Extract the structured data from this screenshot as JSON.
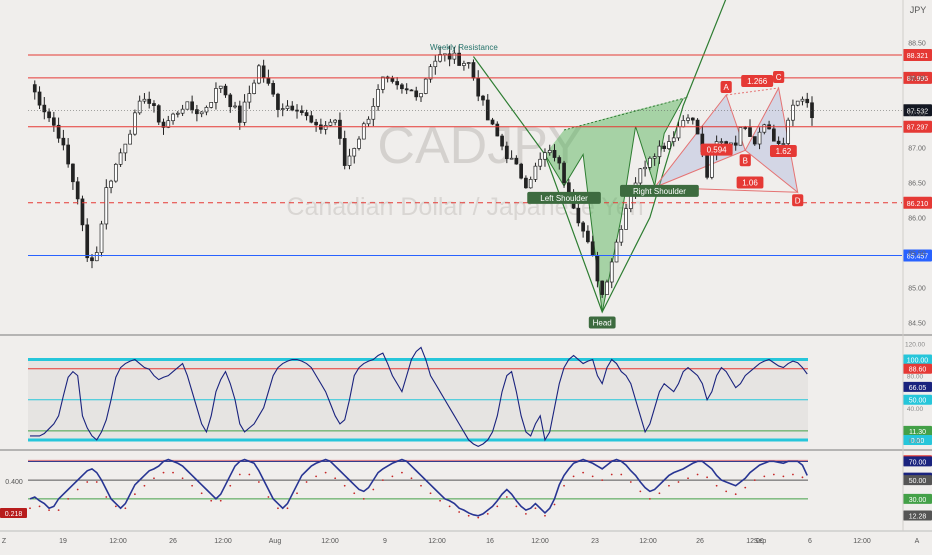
{
  "currency": "JPY",
  "watermark": {
    "symbol": "CADJPY",
    "name": "Canadian Dollar / Japanese Yen"
  },
  "colors": {
    "bg": "#f0eeec",
    "up": "#ffffff",
    "down": "#222222",
    "wick": "#222222",
    "resistance": "#e53935",
    "support": "#2962ff",
    "pattern_fill": "#4caf50",
    "pattern_line": "#2e7d32",
    "butterfly_fill": "#9fa8da",
    "butterfly_line": "#e57373",
    "osc_line": "#1a237e",
    "cyan": "#26c6da",
    "green_level": "#43a047",
    "sep": "#7a7a7a"
  },
  "chart_data": [
    {
      "type": "candlestick",
      "title": "",
      "ylim": [
        84.35,
        89.05
      ],
      "y_ticks": [
        84.5,
        85.0,
        85.5,
        86.0,
        86.5,
        87.0,
        87.5,
        88.0,
        88.5
      ],
      "x_tick_labels": [
        "Z",
        "19",
        "12:00",
        "26",
        "12:00",
        "Aug",
        "12:00",
        "9",
        "12:00",
        "16",
        "12:00",
        "23",
        "12:00",
        "26",
        "12:00",
        "Sep",
        "6",
        "12:00",
        "A"
      ],
      "anchors": [
        [
          0,
          87.9
        ],
        [
          6,
          87.2
        ],
        [
          10,
          86.3
        ],
        [
          12,
          85.4
        ],
        [
          14,
          85.5
        ],
        [
          16,
          86.4
        ],
        [
          20,
          87.1
        ],
        [
          24,
          87.75
        ],
        [
          28,
          87.3
        ],
        [
          32,
          87.6
        ],
        [
          36,
          87.5
        ],
        [
          40,
          87.9
        ],
        [
          44,
          87.4
        ],
        [
          48,
          88.15
        ],
        [
          52,
          87.6
        ],
        [
          56,
          87.6
        ],
        [
          60,
          87.25
        ],
        [
          64,
          87.4
        ],
        [
          66,
          86.75
        ],
        [
          70,
          87.3
        ],
        [
          74,
          87.95
        ],
        [
          78,
          87.8
        ],
        [
          82,
          87.8
        ],
        [
          84,
          88.2
        ],
        [
          86,
          88.3
        ],
        [
          88,
          88.3
        ],
        [
          92,
          88.2
        ],
        [
          96,
          87.4
        ],
        [
          100,
          86.9
        ],
        [
          104,
          86.5
        ],
        [
          108,
          86.9
        ],
        [
          110,
          86.9
        ],
        [
          114,
          86.2
        ],
        [
          118,
          85.4
        ],
        [
          120,
          84.9
        ],
        [
          122,
          85.4
        ],
        [
          126,
          86.4
        ],
        [
          130,
          86.9
        ],
        [
          134,
          87.1
        ],
        [
          138,
          87.5
        ],
        [
          140,
          87.2
        ],
        [
          142,
          86.6
        ],
        [
          144,
          87.05
        ],
        [
          148,
          87.1
        ],
        [
          150,
          87.35
        ],
        [
          152,
          87.1
        ],
        [
          154,
          87.4
        ],
        [
          156,
          87.1
        ],
        [
          158,
          87.05
        ],
        [
          160,
          87.6
        ],
        [
          162,
          87.75
        ],
        [
          164,
          87.4
        ]
      ],
      "levels": [
        {
          "label": "88.321",
          "value": 88.321,
          "style": "solid",
          "color": "#e53935"
        },
        {
          "label": "87.995",
          "value": 87.995,
          "style": "solid",
          "color": "#e53935"
        },
        {
          "label": "87.297",
          "value": 87.297,
          "style": "solid",
          "color": "#e53935"
        },
        {
          "label": "86.210",
          "value": 86.21,
          "style": "dashed",
          "color": "#e53935"
        },
        {
          "label": "85.457",
          "value": 85.457,
          "style": "solid",
          "color": "#2962ff"
        }
      ],
      "price_label": {
        "label": "87.532",
        "value": 87.532
      },
      "annotations": {
        "weekly_resistance": "Weekly Resistance",
        "left_shoulder": "Left Shoulder",
        "head": "Head",
        "right_shoulder": "Right Shoulder",
        "points": {
          "A": "A",
          "B": "B",
          "C": "C",
          "D": "D"
        },
        "ratios": {
          "ab": "0.594",
          "ac": "1.266",
          "bd": "1.62",
          "xd": "1.06"
        }
      },
      "pattern": {
        "hs_path": [
          [
            108,
            86.9
          ],
          [
            112,
            86.45
          ],
          [
            116,
            86.9
          ],
          [
            120,
            84.65
          ],
          [
            124,
            86.0
          ],
          [
            127,
            87.3
          ],
          [
            131,
            86.45
          ],
          [
            133,
            87.2
          ],
          [
            137,
            87.7
          ]
        ],
        "trend_line": [
          [
            93,
            88.3
          ],
          [
            108,
            86.9
          ],
          [
            120,
            84.65
          ],
          [
            130,
            86.0
          ],
          [
            137,
            87.6
          ],
          [
            147,
            89.3
          ]
        ],
        "butterfly": {
          "X": [
            131,
            86.43
          ],
          "A": [
            146,
            87.75
          ],
          "B": [
            150,
            86.96
          ],
          "C": [
            157,
            87.85
          ],
          "D": [
            161,
            86.36
          ]
        }
      }
    },
    {
      "type": "line",
      "title": "",
      "ylim": [
        -10,
        128
      ],
      "y_ticks": [
        0.0,
        40.0,
        80.0,
        120.0
      ],
      "levels": [
        {
          "label": "100.00",
          "value": 100.0,
          "color": "#26c6da"
        },
        {
          "label": "88.60",
          "value": 88.6,
          "color": "#e53935"
        },
        {
          "label": "66.05",
          "value": 66.05,
          "color": "#1a237e"
        },
        {
          "label": "50.00",
          "value": 50.0,
          "color": "#26c6da"
        },
        {
          "label": "11.30",
          "value": 11.3,
          "color": "#43a047"
        },
        {
          "label": "0.00",
          "value": 0.0,
          "color": "#26c6da"
        }
      ],
      "series": [
        {
          "values": [
            5,
            5,
            5,
            8,
            14,
            20,
            30,
            55,
            78,
            85,
            80,
            30,
            15,
            5,
            0,
            10,
            25,
            50,
            78,
            90,
            95,
            98,
            100,
            95,
            90,
            88,
            80,
            75,
            78,
            80,
            85,
            90,
            95,
            80,
            60,
            40,
            20,
            10,
            30,
            60,
            75,
            85,
            70,
            50,
            20,
            10,
            15,
            20,
            30,
            40,
            60,
            80,
            90,
            95,
            98,
            100,
            100,
            98,
            95,
            90,
            80,
            70,
            60,
            45,
            30,
            20,
            25,
            50,
            80,
            90,
            95,
            98,
            100,
            105,
            108,
            95,
            80,
            70,
            60,
            80,
            100,
            110,
            115,
            100,
            80,
            70,
            60,
            50,
            40,
            30,
            20,
            10,
            0,
            -5,
            -8,
            -5,
            0,
            10,
            30,
            60,
            80,
            85,
            60,
            30,
            10,
            5,
            20,
            30,
            0,
            10,
            40,
            70,
            90,
            100,
            105,
            100,
            95,
            98,
            100,
            80,
            70,
            90,
            100,
            95,
            85,
            80,
            70,
            50,
            30,
            10,
            20,
            40,
            60,
            70,
            65,
            60,
            70,
            85,
            90,
            85,
            80,
            70,
            50,
            60,
            80,
            90,
            85,
            75,
            65,
            70,
            80,
            85,
            90,
            95,
            98,
            100,
            96,
            92,
            90,
            95,
            98,
            96,
            90,
            82
          ]
        }
      ]
    },
    {
      "type": "line",
      "title": "",
      "ylim": [
        0,
        80
      ],
      "y_ticks": [
        0.4
      ],
      "y_tick_label": "0.400",
      "left_value": "0.218",
      "levels": [
        {
          "label": "71.16",
          "value": 71.16,
          "color": "#e53935"
        },
        {
          "label": "70.00",
          "value": 70.0,
          "color": "#1a237e"
        },
        {
          "label": "52.69",
          "value": 52.69,
          "color": "#1a237e"
        },
        {
          "label": "50.00",
          "value": 50.0,
          "color": "#555555"
        },
        {
          "label": "30.00",
          "value": 30.0,
          "color": "#43a047"
        },
        {
          "label": "12.28",
          "value": 12.28,
          "color": "#555555"
        }
      ],
      "series": [
        {
          "values": [
            30,
            32,
            28,
            25,
            20,
            22,
            30,
            35,
            40,
            45,
            50,
            55,
            60,
            62,
            58,
            50,
            40,
            30,
            25,
            20,
            25,
            35,
            45,
            50,
            55,
            60,
            62,
            65,
            70,
            72,
            70,
            68,
            65,
            60,
            55,
            50,
            45,
            40,
            35,
            30,
            35,
            45,
            55,
            65,
            70,
            72,
            70,
            68,
            60,
            50,
            40,
            30,
            25,
            20,
            25,
            35,
            45,
            55,
            60,
            65,
            68,
            70,
            72,
            70,
            65,
            60,
            55,
            50,
            45,
            40,
            38,
            42,
            50,
            58,
            62,
            65,
            68,
            70,
            72,
            70,
            65,
            60,
            55,
            50,
            45,
            40,
            35,
            30,
            28,
            25,
            20,
            18,
            15,
            13,
            12,
            14,
            18,
            22,
            28,
            35,
            40,
            35,
            28,
            22,
            18,
            20,
            25,
            20,
            15,
            20,
            30,
            45,
            55,
            62,
            68,
            70,
            72,
            70,
            68,
            65,
            62,
            66,
            70,
            72,
            70,
            66,
            60,
            55,
            48,
            42,
            38,
            40,
            45,
            50,
            55,
            58,
            60,
            62,
            65,
            68,
            70,
            70,
            66,
            62,
            55,
            50,
            48,
            46,
            44,
            48,
            52,
            58,
            62,
            66,
            68,
            70,
            70,
            69,
            68,
            70,
            70,
            70,
            66,
            55
          ]
        }
      ],
      "dots": [
        20,
        20,
        22,
        20,
        18,
        15,
        18,
        25,
        30,
        35,
        40,
        45,
        48,
        50,
        48,
        40,
        32,
        26,
        22,
        18,
        20,
        28,
        35,
        40,
        44,
        48,
        52,
        55,
        58,
        60,
        58,
        55,
        52,
        48,
        44,
        40,
        36,
        32,
        28,
        24,
        28,
        36,
        44,
        52,
        56,
        58,
        56,
        54,
        48,
        40,
        32,
        24,
        20,
        16,
        20,
        28,
        36,
        44,
        48,
        52,
        54,
        56,
        58,
        56,
        52,
        48,
        44,
        40,
        36,
        32,
        30,
        34,
        40,
        46,
        50,
        52,
        54,
        56,
        58,
        56,
        52,
        48,
        44,
        40,
        36,
        32,
        28,
        24,
        22,
        20,
        16,
        14,
        12,
        10,
        10,
        12,
        14,
        18,
        22,
        28,
        32,
        28,
        22,
        18,
        14,
        16,
        20,
        16,
        12,
        16,
        24,
        36,
        44,
        50,
        54,
        56,
        58,
        56,
        54,
        52,
        50,
        53,
        56,
        58,
        56,
        53,
        48,
        44,
        38,
        34,
        30,
        32,
        36,
        40,
        44,
        46,
        48,
        50,
        52,
        54,
        56,
        56,
        53,
        50,
        44,
        40,
        38,
        37,
        35,
        38,
        42,
        46,
        50,
        53,
        54,
        56,
        56,
        55,
        54,
        56,
        56,
        56,
        53,
        44
      ]
    }
  ]
}
